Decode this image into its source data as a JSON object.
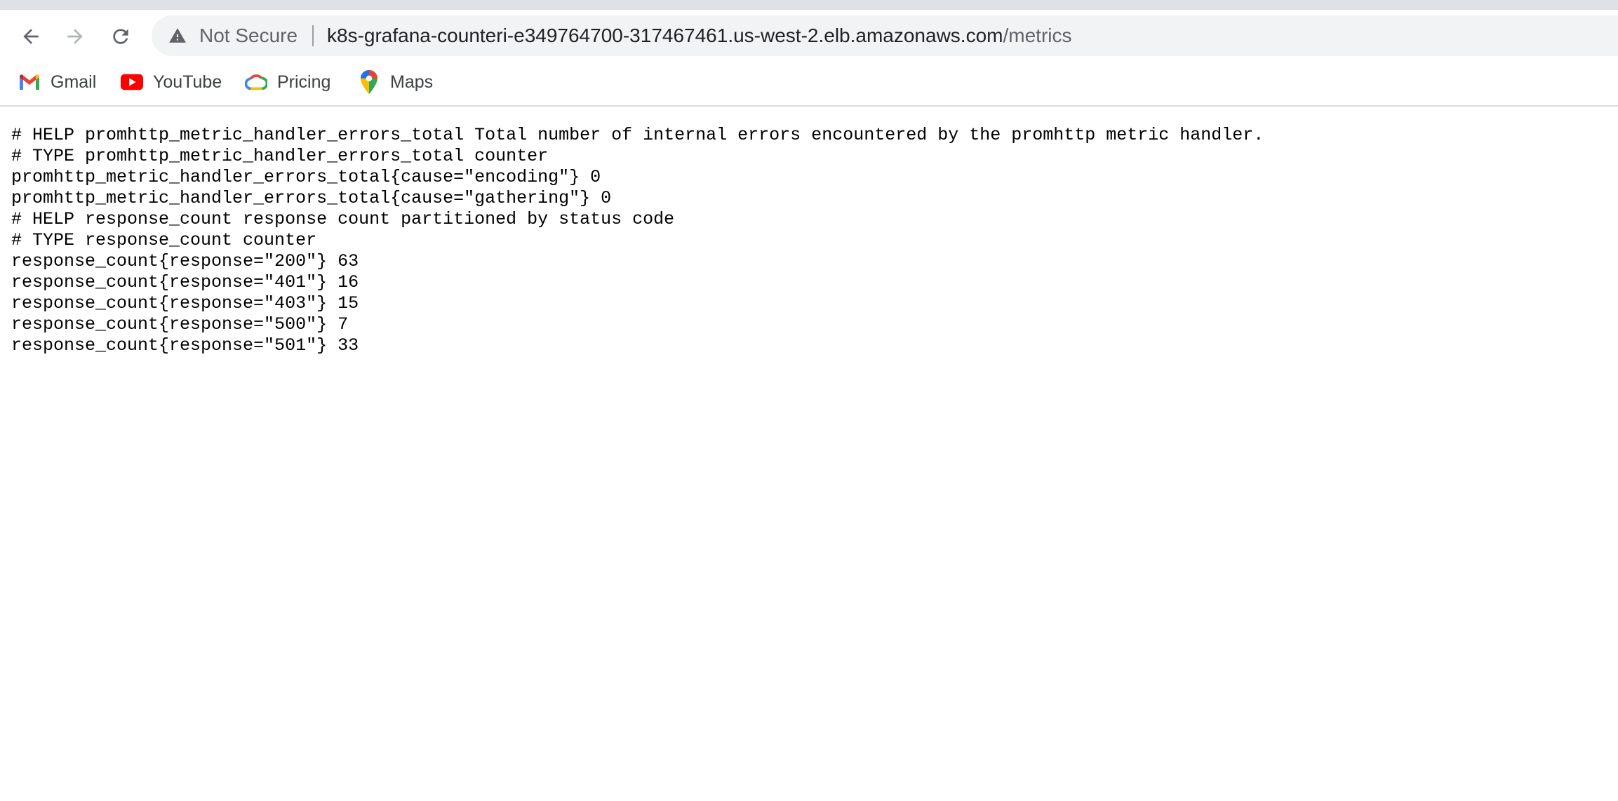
{
  "browser": {
    "security_label": "Not Secure",
    "url_host": "k8s-grafana-counteri-e349764700-317467461.us-west-2.elb.amazonaws.com",
    "url_path": "/metrics",
    "icons": {
      "back": "arrow-left-icon",
      "forward": "arrow-right-icon",
      "reload": "reload-icon",
      "security": "warning-triangle-icon"
    }
  },
  "bookmarks": [
    {
      "label": "Gmail",
      "icon": "gmail-icon"
    },
    {
      "label": "YouTube",
      "icon": "youtube-icon"
    },
    {
      "label": "Pricing",
      "icon": "google-cloud-icon"
    },
    {
      "label": "Maps",
      "icon": "maps-pin-icon"
    }
  ],
  "page": {
    "lines": [
      "# HELP promhttp_metric_handler_errors_total Total number of internal errors encountered by the promhttp metric handler.",
      "# TYPE promhttp_metric_handler_errors_total counter",
      "promhttp_metric_handler_errors_total{cause=\"encoding\"} 0",
      "promhttp_metric_handler_errors_total{cause=\"gathering\"} 0",
      "# HELP response_count response count partitioned by status code",
      "# TYPE response_count counter",
      "response_count{response=\"200\"} 63",
      "response_count{response=\"401\"} 16",
      "response_count{response=\"403\"} 15",
      "response_count{response=\"500\"} 7",
      "response_count{response=\"501\"} 33"
    ]
  },
  "colors": {
    "toolbar_bg": "#ffffff",
    "omnibox_bg": "#f1f3f4",
    "tab_strip": "#dee1e6",
    "gmail_red": "#ea4335",
    "youtube_red": "#ff0000"
  }
}
